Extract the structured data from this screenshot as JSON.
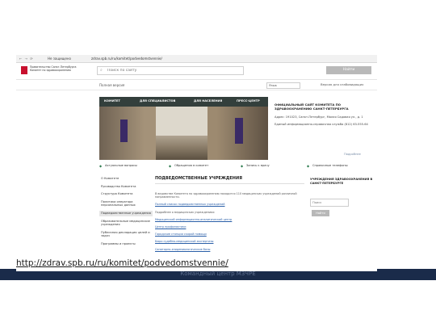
{
  "browser": {
    "tab_title": "Не защищено",
    "address": "zdrav.spb.ru/ru/komitet/podvedomstvennie/",
    "nav_glyphs": "← → ⟳"
  },
  "header": {
    "logo_text": "Правительство Санкт-Петербурга Комитет по здравоохранению",
    "search_placeholder": "Поиск по сайту",
    "search_button": "Найти"
  },
  "subbar": {
    "site_label": "Полная версия",
    "language": "Язык",
    "accessibility": "Версия для слабовидящих"
  },
  "nav": {
    "items": [
      "КОМИТЕТ",
      "ДЛЯ СПЕЦИАЛИСТОВ",
      "ДЛЯ НАСЕЛЕНИЯ",
      "ПРЕСС-ЦЕНТР"
    ]
  },
  "info": {
    "title": "ОФИЦИАЛЬНЫЙ САЙТ КОМИТЕТА ПО ЗДРАВООХРАНЕНИЮ САНКТ-ПЕТЕРБУРГА",
    "address": "Адрес: 191023, Санкт-Петербург, Малая Садовая ул., д. 1",
    "phone": "Единый информационно-справочная служба (812) 63-555-64",
    "more": "Подробнее"
  },
  "quicklinks": [
    "Актуальные вопросы",
    "Обращения в комитет",
    "Запись к врачу",
    "Справочные телефоны"
  ],
  "sidebar": {
    "items": [
      "О Комитете",
      "Руководство Комитета",
      "Структура Комитета",
      "Политика оператора персональных данных",
      "Подведомственные учреждения",
      "Образовательные медицинские учреждения",
      "Публичная декларация целей и задач",
      "Программы и проекты"
    ],
    "active_index": 4
  },
  "content": {
    "heading": "ПОДВЕДОМСТВЕННЫЕ УЧРЕЖДЕНИЯ",
    "intro": "В ведомстве Комитета по здравоохранению находится 110 медицинских учреждений различной направленности.",
    "link1": "Полный список подведомственных учреждений",
    "sub": "Подробнее о медицинских учреждениях:",
    "links": [
      "Медицинский информационно-аналитический центр",
      "Центр профилактики",
      "Городские станции скорой помощи",
      "Бюро судебно-медицинской экспертизы",
      "Санитарно-эпидемиологические базы"
    ]
  },
  "rightpanel": {
    "heading": "УЧРЕЖДЕНИЯ ЗДРАВООХРАНЕНИЯ В САНКТ-ПЕТЕРБУРГЕ",
    "input_placeholder": "Поиск",
    "button": "Найти"
  },
  "slide": {
    "url": "http://zdrav.spb.ru/ru/komitet/podvedomstvennie/",
    "footer": "Командный центр МЗЧРЕ"
  }
}
